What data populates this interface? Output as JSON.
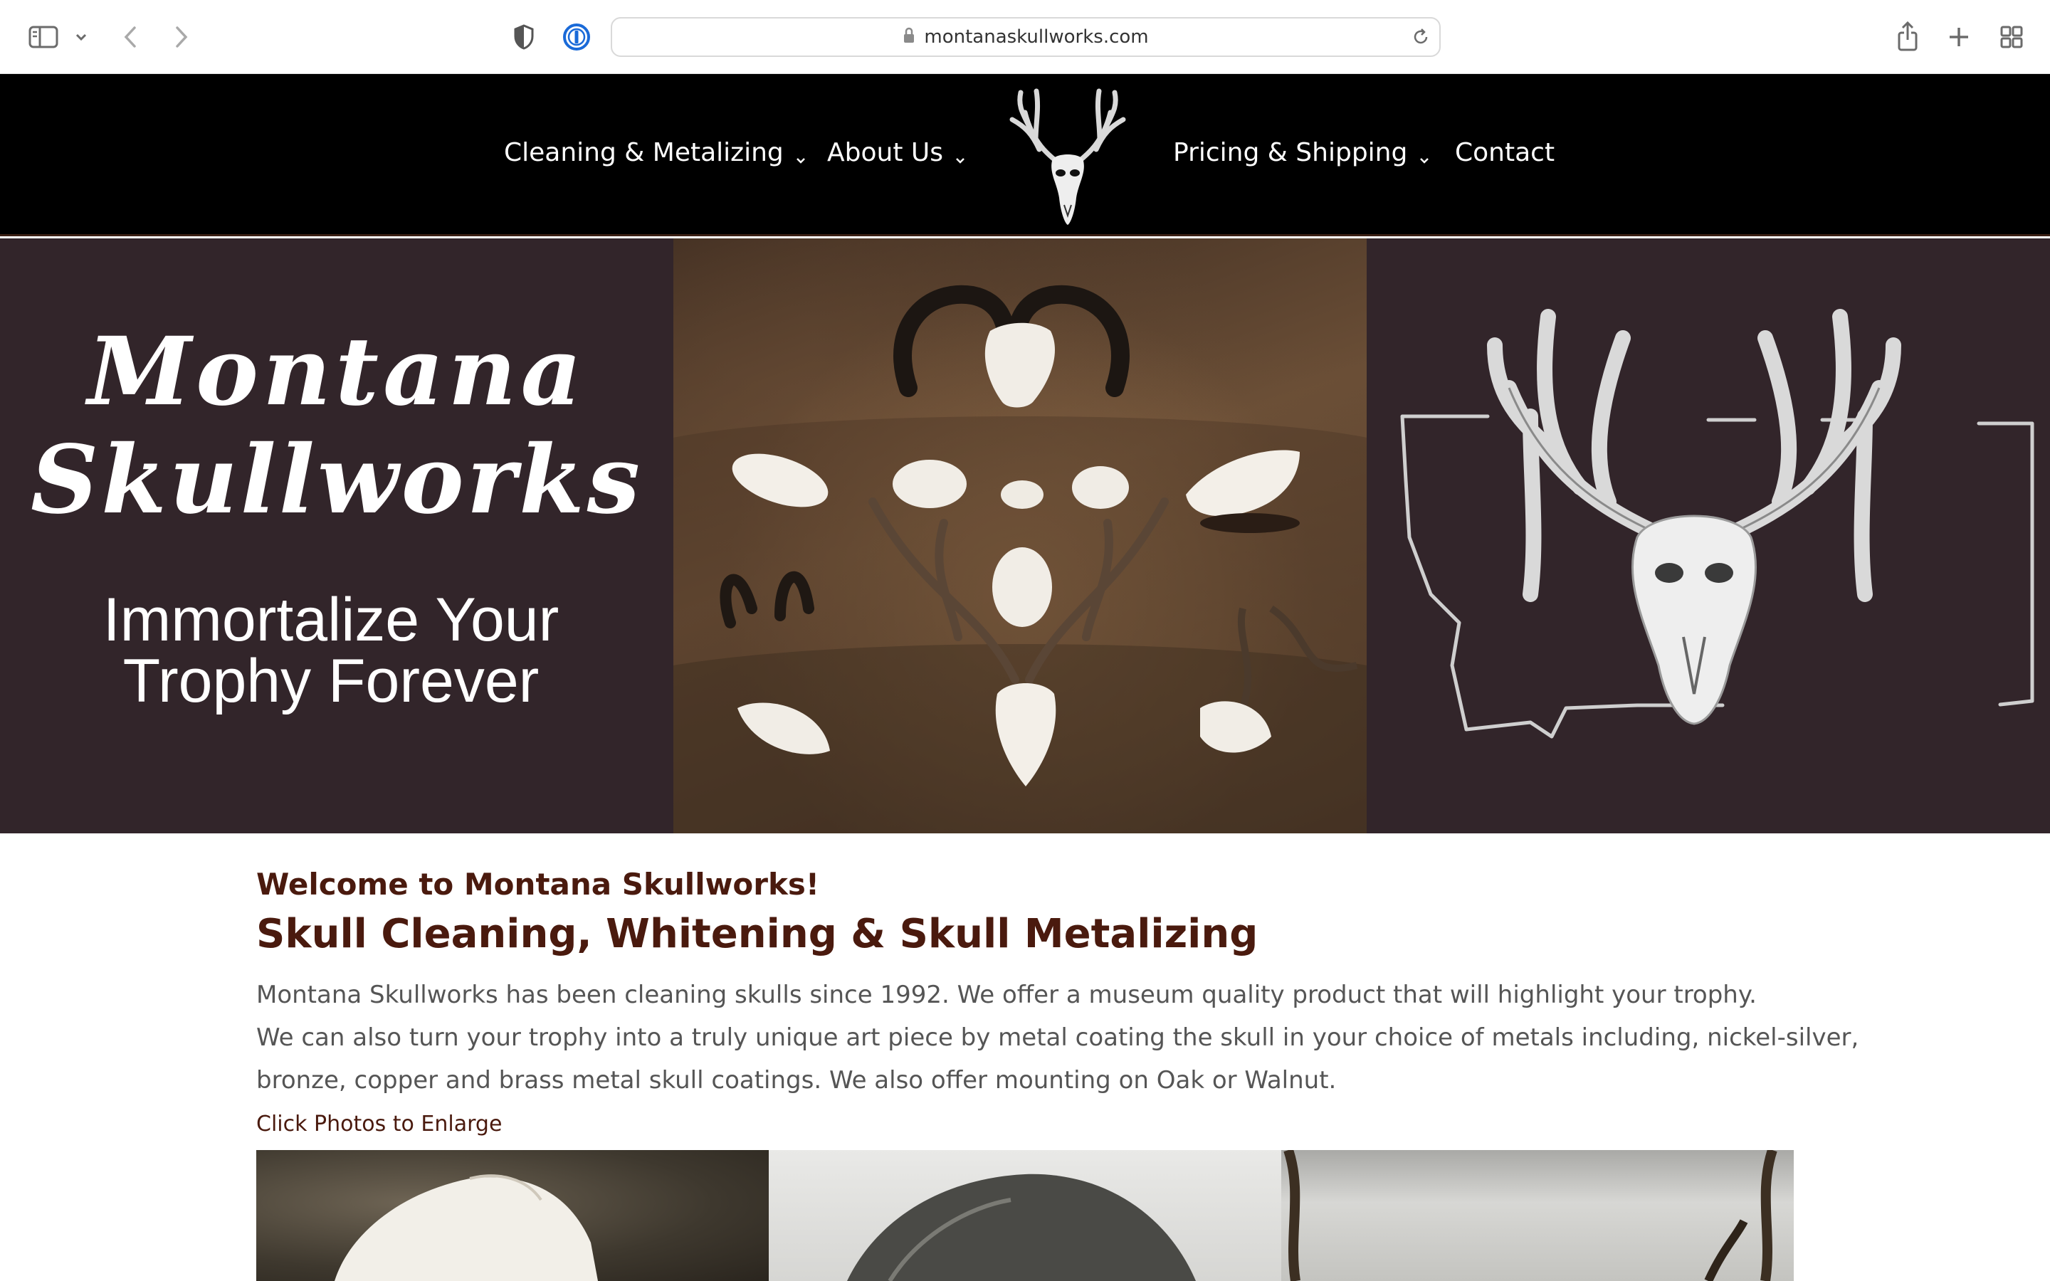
{
  "browser": {
    "url": "montanaskullworks.com",
    "icons": [
      "sidebar-toggle-icon",
      "chevron-down-icon",
      "back-icon",
      "forward-icon",
      "privacy-shield-icon",
      "password-manager-icon",
      "lock-icon",
      "reload-icon",
      "share-icon",
      "new-tab-icon",
      "tab-overview-icon"
    ]
  },
  "nav": {
    "items": [
      {
        "label": "Cleaning & Metalizing",
        "has_dropdown": true
      },
      {
        "label": "About Us",
        "has_dropdown": true
      },
      {
        "label": "Pricing & Shipping",
        "has_dropdown": true
      },
      {
        "label": "Contact",
        "has_dropdown": false
      }
    ],
    "logo_icon": "deer-skull-logo-icon"
  },
  "hero": {
    "brand_line1": "Montana",
    "brand_line2": "Skullworks",
    "tagline_line1": "Immortalize Your",
    "tagline_line2": "Trophy Forever",
    "photo_subject": "cleaned animal skulls display",
    "emblem_icon": "montana-state-deer-skull-icon"
  },
  "main": {
    "welcome": "Welcome to Montana Skullworks!",
    "headline": "Skull Cleaning, Whitening & Skull Metalizing",
    "paragraph_lines": [
      "Montana Skullworks has been cleaning skulls since 1992. We offer a museum quality product that will highlight your trophy.",
      "We can also turn your trophy into a truly unique art piece by metal coating the skull in your choice of metals including, nickel-silver,",
      "bronze, copper and brass metal skull coatings. We also offer mounting on Oak or Walnut."
    ],
    "click_note": "Click Photos to Enlarge"
  },
  "colors": {
    "header_bg": "#000000",
    "hero_bg": "#32252a",
    "heading": "#4a1a0e",
    "body_text": "#555555"
  }
}
